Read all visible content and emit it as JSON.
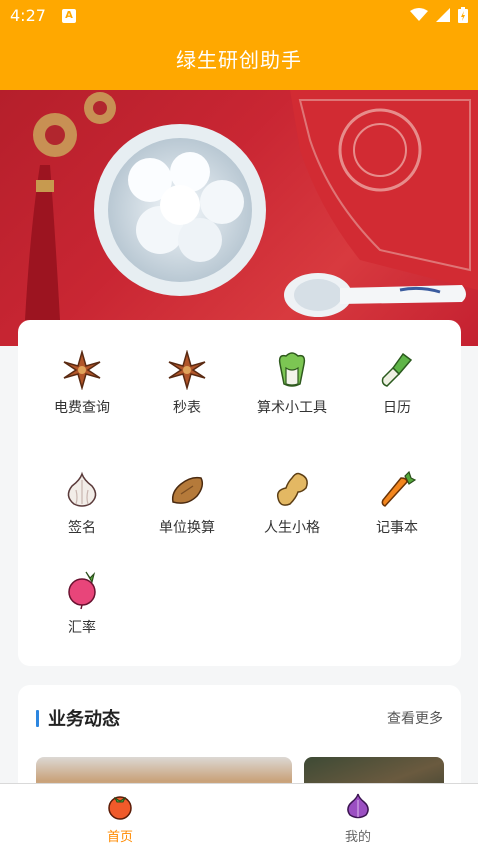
{
  "status_bar": {
    "time": "4:27",
    "notification_letter": "A"
  },
  "app": {
    "title": "绿生研创助手"
  },
  "grid": {
    "items": [
      {
        "label": "电费查询",
        "icon": "star-anise-icon"
      },
      {
        "label": "秒表",
        "icon": "star-anise-icon"
      },
      {
        "label": "算术小工具",
        "icon": "cabbage-icon"
      },
      {
        "label": "日历",
        "icon": "leek-icon"
      },
      {
        "label": "签名",
        "icon": "garlic-icon"
      },
      {
        "label": "单位换算",
        "icon": "sweet-potato-icon"
      },
      {
        "label": "人生小格",
        "icon": "peanut-icon"
      },
      {
        "label": "记事本",
        "icon": "carrot-icon"
      },
      {
        "label": "汇率",
        "icon": "radish-icon"
      }
    ]
  },
  "news": {
    "title": "业务动态",
    "more": "查看更多"
  },
  "bottom_nav": {
    "home": {
      "label": "首页",
      "icon": "tomato-icon"
    },
    "mine": {
      "label": "我的",
      "icon": "onion-icon"
    }
  },
  "colors": {
    "brand": "#ffa800",
    "active_tab": "#ff8a00",
    "accent_bar": "#2c86e0"
  }
}
